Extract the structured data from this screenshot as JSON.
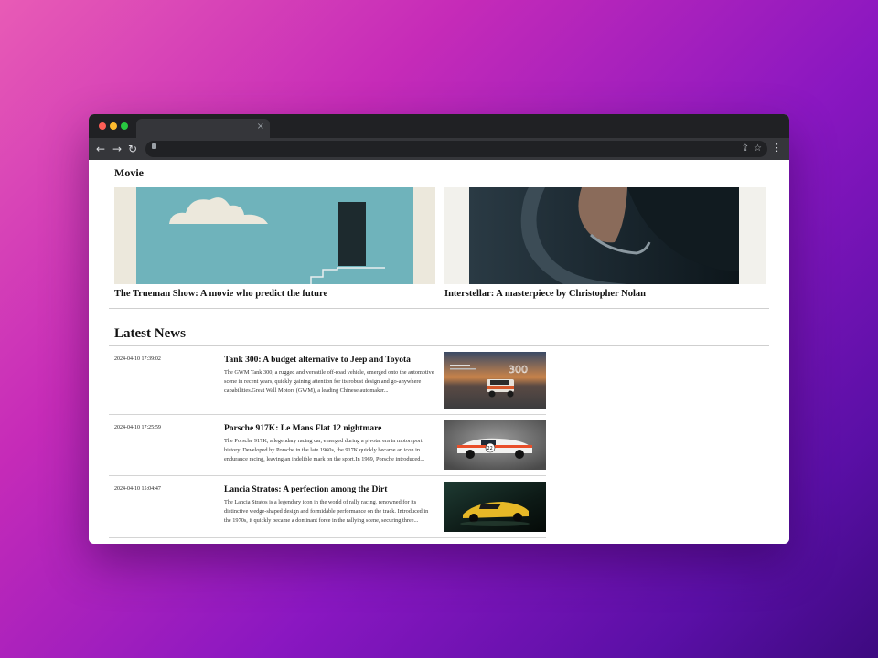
{
  "browser": {
    "tab_close": "×",
    "back": "←",
    "forward": "→",
    "reload": "↻",
    "share": "⇪",
    "star": "☆",
    "menu": "⋮"
  },
  "movie": {
    "section_title": "Movie",
    "cards": [
      {
        "caption": "The Trueman Show: A movie who predict the future"
      },
      {
        "caption": "Interstellar: A masterpiece by Christopher Nolan"
      }
    ]
  },
  "news": {
    "section_title": "Latest News",
    "items": [
      {
        "date": "2024-04-10 17:39:02",
        "headline": "Tank 300: A budget alternative to Jeep and Toyota",
        "excerpt": "The GWM Tank 300, a rugged and versatile off-road vehicle, emerged onto the automotive scene in recent years, quickly gaining attention for its robust design and go-anywhere capabilities.Great Wall Motors (GWM), a leading Chinese automaker...",
        "thumb_text": "300"
      },
      {
        "date": "2024-04-10 17:25:59",
        "headline": "Porsche 917K: Le Mans Flat 12 nightmare",
        "excerpt": "The Porsche 917K, a legendary racing car, emerged during a pivotal era in motorsport history. Developed by Porsche in the late 1960s, the 917K quickly became an icon in endurance racing, leaving an indelible mark on the sport.In 1969, Porsche introduced...",
        "thumb_text": "22"
      },
      {
        "date": "2024-04-10 15:04:47",
        "headline": "Lancia Stratos: A perfection among the Dirt",
        "excerpt": "The Lancia Stratos is a legendary icon in the world of rally racing, renowned for its distinctive wedge-shaped design and formidable performance on the track. Introduced in the 1970s, it quickly became a dominant force in the rallying scene, securing three...",
        "thumb_text": ""
      }
    ]
  }
}
